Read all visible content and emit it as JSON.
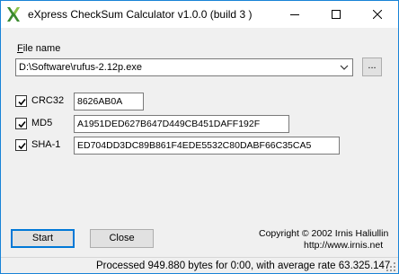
{
  "window": {
    "title": "eXpress CheckSum Calculator v1.0.0 (build 3 )"
  },
  "file": {
    "label_underlined": "F",
    "label_rest": "ile name",
    "path": "D:\\Software\\rufus-2.12p.exe",
    "browse_label": "..."
  },
  "hashes": [
    {
      "label": "CRC32",
      "checked": true,
      "value": "8626AB0A"
    },
    {
      "label": "MD5",
      "checked": true,
      "value": "A1951DED627B647D449CB451DAFF192F"
    },
    {
      "label": "SHA-1",
      "checked": true,
      "value": "ED704DD3DC89B861F4EDE5532C80DABF66C35CA5"
    }
  ],
  "about": {
    "copyright": "Copyright © 2002 Irnis Haliullin",
    "website": "http://www.irnis.net"
  },
  "buttons": {
    "start": "Start",
    "close": "Close"
  },
  "status": {
    "text": "Processed 949.880 bytes for 0:00, with average rate 63.325.147"
  },
  "colors": {
    "accent": "#0078d7",
    "window_border": "#1883d7",
    "background": "#f0f0f0"
  }
}
